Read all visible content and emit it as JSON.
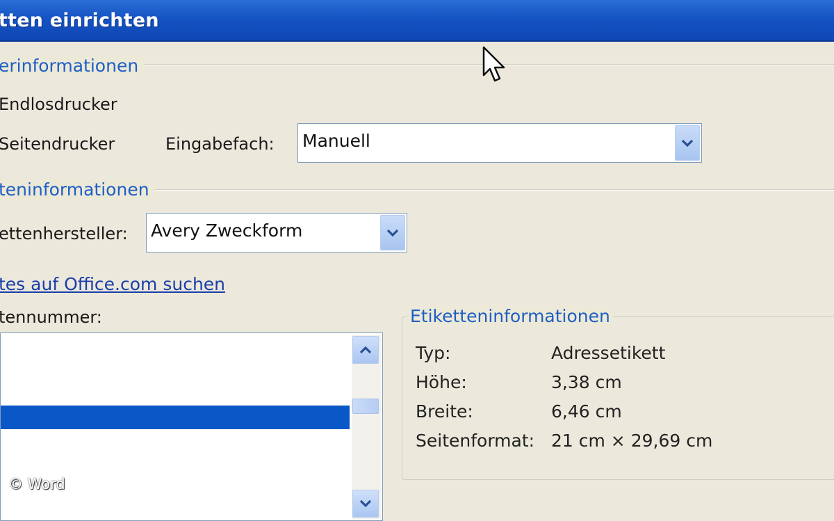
{
  "window": {
    "title": "tten einrichten"
  },
  "printer_info": {
    "label": "erinformationen",
    "continuous_label": "Endlosdrucker",
    "page_label": "Seitendrucker",
    "tray_label": "Eingabefach:",
    "tray_value": "Manuell"
  },
  "label_info": {
    "label": "teninformationen",
    "vendor_label": "ettenhersteller:",
    "vendor_value": "Avery Zweckform",
    "office_link": "tes auf Office.com suchen",
    "product_number_label": "tennummer:"
  },
  "details": {
    "label": "Etiketteninformationen",
    "rows": [
      {
        "key": "Typ:",
        "value": "Adressetikett"
      },
      {
        "key": "Höhe:",
        "value": "3,38 cm"
      },
      {
        "key": "Breite:",
        "value": "6,46 cm"
      },
      {
        "key": "Seitenformat:",
        "value": "21 cm × 29,69 cm"
      }
    ]
  },
  "watermark": "© Word",
  "icons": {
    "dropdown": "chevron-down-icon",
    "scroll_up": "chevron-up-icon",
    "scroll_down": "chevron-down-icon",
    "cursor": "mouse-pointer-icon"
  },
  "colors": {
    "titlebar": "#1553c4",
    "group_label": "#1f5fc4",
    "selection": "#0a58c7",
    "background": "#ece9d8"
  }
}
